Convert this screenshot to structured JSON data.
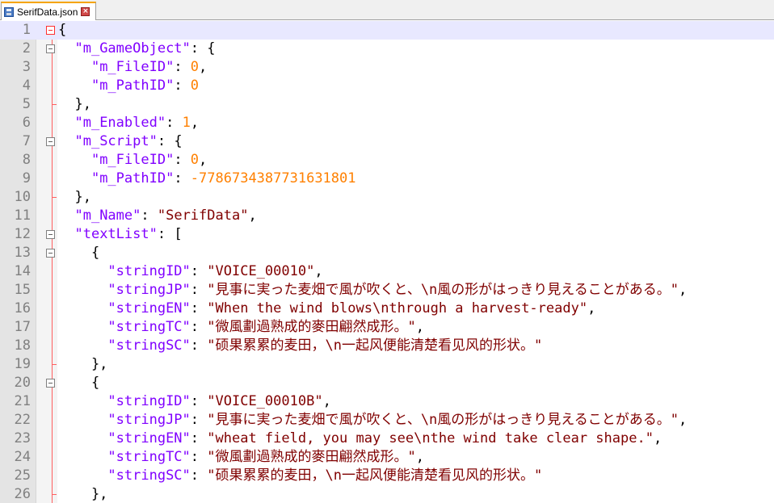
{
  "tab": {
    "label": "SerifData.json"
  },
  "lines": [
    {
      "n": "1",
      "tokens": [
        [
          "p",
          "{"
        ]
      ]
    },
    {
      "n": "2",
      "tokens": [
        [
          "p",
          "  "
        ],
        [
          "k",
          "\"m_GameObject\""
        ],
        [
          "p",
          ": {"
        ]
      ]
    },
    {
      "n": "3",
      "tokens": [
        [
          "p",
          "    "
        ],
        [
          "k",
          "\"m_FileID\""
        ],
        [
          "p",
          ": "
        ],
        [
          "n",
          "0"
        ],
        [
          "p",
          ","
        ]
      ]
    },
    {
      "n": "4",
      "tokens": [
        [
          "p",
          "    "
        ],
        [
          "k",
          "\"m_PathID\""
        ],
        [
          "p",
          ": "
        ],
        [
          "n",
          "0"
        ]
      ]
    },
    {
      "n": "5",
      "tokens": [
        [
          "p",
          "  },"
        ]
      ]
    },
    {
      "n": "6",
      "tokens": [
        [
          "p",
          "  "
        ],
        [
          "k",
          "\"m_Enabled\""
        ],
        [
          "p",
          ": "
        ],
        [
          "n",
          "1"
        ],
        [
          "p",
          ","
        ]
      ]
    },
    {
      "n": "7",
      "tokens": [
        [
          "p",
          "  "
        ],
        [
          "k",
          "\"m_Script\""
        ],
        [
          "p",
          ": {"
        ]
      ]
    },
    {
      "n": "8",
      "tokens": [
        [
          "p",
          "    "
        ],
        [
          "k",
          "\"m_FileID\""
        ],
        [
          "p",
          ": "
        ],
        [
          "n",
          "0"
        ],
        [
          "p",
          ","
        ]
      ]
    },
    {
      "n": "9",
      "tokens": [
        [
          "p",
          "    "
        ],
        [
          "k",
          "\"m_PathID\""
        ],
        [
          "p",
          ": "
        ],
        [
          "n",
          "-7786734387731631801"
        ]
      ]
    },
    {
      "n": "10",
      "tokens": [
        [
          "p",
          "  },"
        ]
      ]
    },
    {
      "n": "11",
      "tokens": [
        [
          "p",
          "  "
        ],
        [
          "k",
          "\"m_Name\""
        ],
        [
          "p",
          ": "
        ],
        [
          "s",
          "\"SerifData\""
        ],
        [
          "p",
          ","
        ]
      ]
    },
    {
      "n": "12",
      "tokens": [
        [
          "p",
          "  "
        ],
        [
          "k",
          "\"textList\""
        ],
        [
          "p",
          ": ["
        ]
      ]
    },
    {
      "n": "13",
      "tokens": [
        [
          "p",
          "    {"
        ]
      ]
    },
    {
      "n": "14",
      "tokens": [
        [
          "p",
          "      "
        ],
        [
          "k",
          "\"stringID\""
        ],
        [
          "p",
          ": "
        ],
        [
          "s",
          "\"VOICE_00010\""
        ],
        [
          "p",
          ","
        ]
      ]
    },
    {
      "n": "15",
      "tokens": [
        [
          "p",
          "      "
        ],
        [
          "k",
          "\"stringJP\""
        ],
        [
          "p",
          ": "
        ],
        [
          "s",
          "\"見事に実った麦畑で風が吹くと、\\n風の形がはっきり見えることがある。\""
        ],
        [
          "p",
          ","
        ]
      ]
    },
    {
      "n": "16",
      "tokens": [
        [
          "p",
          "      "
        ],
        [
          "k",
          "\"stringEN\""
        ],
        [
          "p",
          ": "
        ],
        [
          "s",
          "\"When the wind blows\\nthrough a harvest-ready\""
        ],
        [
          "p",
          ","
        ]
      ]
    },
    {
      "n": "17",
      "tokens": [
        [
          "p",
          "      "
        ],
        [
          "k",
          "\"stringTC\""
        ],
        [
          "p",
          ": "
        ],
        [
          "s",
          "\"微風劃過熟成的麥田翩然成形。\""
        ],
        [
          "p",
          ","
        ]
      ]
    },
    {
      "n": "18",
      "tokens": [
        [
          "p",
          "      "
        ],
        [
          "k",
          "\"stringSC\""
        ],
        [
          "p",
          ": "
        ],
        [
          "s",
          "\"硕果累累的麦田，\\n一起风便能清楚看见风的形状。\""
        ]
      ]
    },
    {
      "n": "19",
      "tokens": [
        [
          "p",
          "    },"
        ]
      ]
    },
    {
      "n": "20",
      "tokens": [
        [
          "p",
          "    {"
        ]
      ]
    },
    {
      "n": "21",
      "tokens": [
        [
          "p",
          "      "
        ],
        [
          "k",
          "\"stringID\""
        ],
        [
          "p",
          ": "
        ],
        [
          "s",
          "\"VOICE_00010B\""
        ],
        [
          "p",
          ","
        ]
      ]
    },
    {
      "n": "22",
      "tokens": [
        [
          "p",
          "      "
        ],
        [
          "k",
          "\"stringJP\""
        ],
        [
          "p",
          ": "
        ],
        [
          "s",
          "\"見事に実った麦畑で風が吹くと、\\n風の形がはっきり見えることがある。\""
        ],
        [
          "p",
          ","
        ]
      ]
    },
    {
      "n": "23",
      "tokens": [
        [
          "p",
          "      "
        ],
        [
          "k",
          "\"stringEN\""
        ],
        [
          "p",
          ": "
        ],
        [
          "s",
          "\"wheat field, you may see\\nthe wind take clear shape.\""
        ],
        [
          "p",
          ","
        ]
      ]
    },
    {
      "n": "24",
      "tokens": [
        [
          "p",
          "      "
        ],
        [
          "k",
          "\"stringTC\""
        ],
        [
          "p",
          ": "
        ],
        [
          "s",
          "\"微風劃過熟成的麥田翩然成形。\""
        ],
        [
          "p",
          ","
        ]
      ]
    },
    {
      "n": "25",
      "tokens": [
        [
          "p",
          "      "
        ],
        [
          "k",
          "\"stringSC\""
        ],
        [
          "p",
          ": "
        ],
        [
          "s",
          "\"硕果累累的麦田，\\n一起风便能清楚看见风的形状。\""
        ]
      ]
    },
    {
      "n": "26",
      "tokens": [
        [
          "p",
          "    },"
        ]
      ]
    }
  ],
  "colors": {
    "key": "#8000ff",
    "string": "#800000",
    "number": "#ff8000",
    "current_line": "#e8e8ff",
    "tab_accent": "#f5a400"
  },
  "icons": {
    "tab_file": "save-icon",
    "tab_close": "close-icon",
    "fold": "fold-minus-icon"
  }
}
